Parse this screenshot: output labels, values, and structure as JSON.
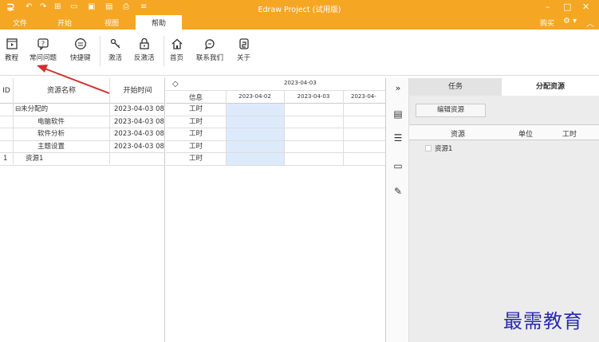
{
  "app": {
    "logo": "⊋",
    "title": "Edraw Project (试用版)",
    "buy": "购买",
    "watermark": "最需教育"
  },
  "menu": {
    "tabs": [
      "文件",
      "开始",
      "视图",
      "帮助"
    ],
    "active": "帮助"
  },
  "ribbon": {
    "buttons": [
      {
        "label": "教程",
        "icon": "film-icon"
      },
      {
        "label": "常问问题",
        "icon": "faq-icon"
      },
      {
        "label": "快捷键",
        "icon": "keyboard-icon"
      },
      {
        "label": "激活",
        "icon": "key-icon"
      },
      {
        "label": "反激活",
        "icon": "lock-icon"
      },
      {
        "label": "首页",
        "icon": "home-icon"
      },
      {
        "label": "联系我们",
        "icon": "chat-icon"
      },
      {
        "label": "关于",
        "icon": "about-icon"
      }
    ]
  },
  "left_grid": {
    "columns": [
      "ID",
      "资源名称",
      "开始时间"
    ],
    "rows": [
      {
        "id": "",
        "name": "⊟未分配的",
        "start": "2023-04-03 08"
      },
      {
        "id": "",
        "name": "电脑软件",
        "start": "2023-04-03 08"
      },
      {
        "id": "",
        "name": "软件分析",
        "start": "2023-04-03 08"
      },
      {
        "id": "",
        "name": "主题设置",
        "start": "2023-04-03 08"
      },
      {
        "id": "1",
        "name": "资源1",
        "start": ""
      }
    ]
  },
  "gantt": {
    "top_date": "2023-04-03",
    "info_header": "信息",
    "dates": [
      "2023-04-02",
      "2023-04-03",
      "2023-04-"
    ],
    "row_label": "工时",
    "row_count": 5
  },
  "right_panel": {
    "tabs": [
      "任务",
      "分配资源"
    ],
    "active_tab": "分配资源",
    "edit_button": "编辑资源",
    "columns": [
      "资源",
      "单位",
      "工时"
    ],
    "rows": [
      {
        "name": "资源1"
      }
    ]
  },
  "colors": {
    "accent": "#f5a623",
    "highlight": "#ddeafc",
    "arrow": "#d32f2f"
  }
}
